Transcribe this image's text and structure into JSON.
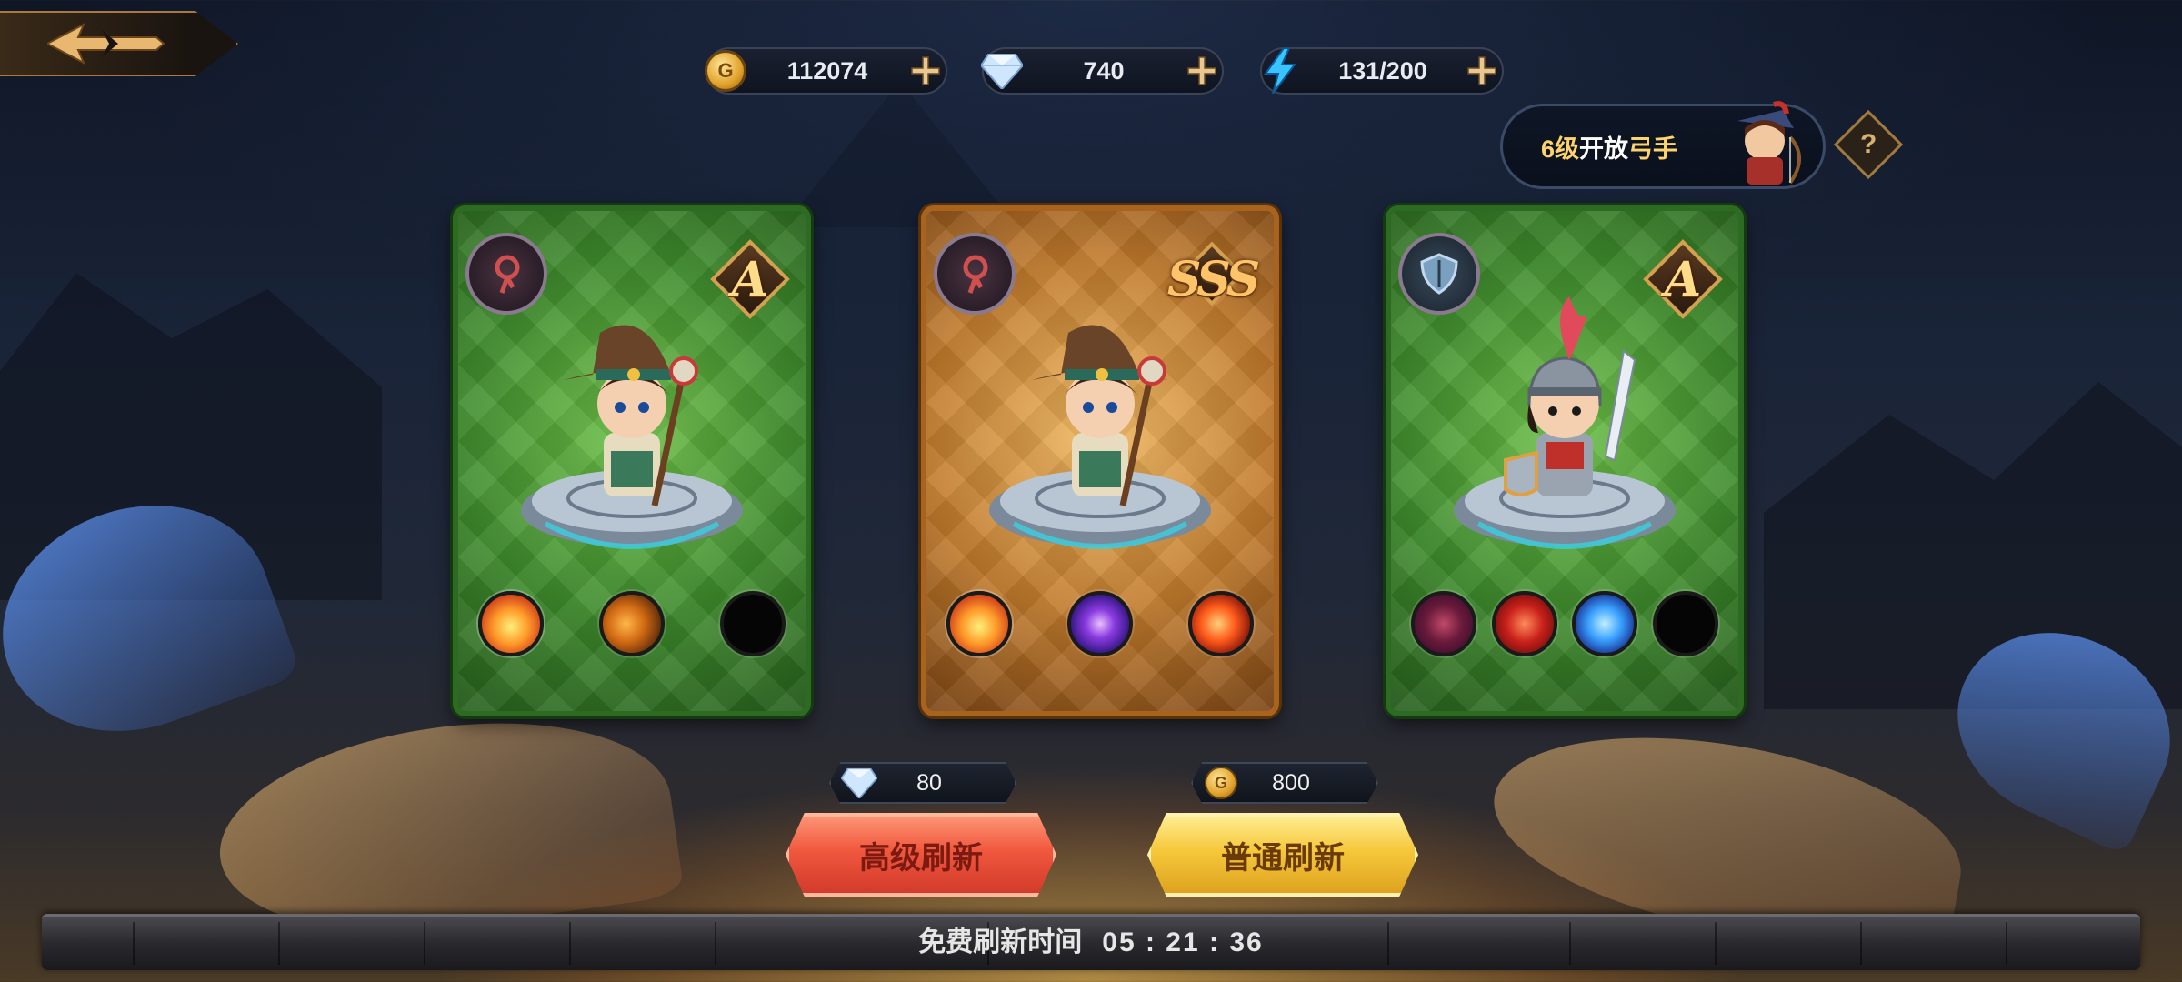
{
  "currencies": {
    "gold": "112074",
    "diamond": "740",
    "energy": "131/200"
  },
  "unlock_banner": {
    "level": "6级",
    "middle": "开放",
    "class": "弓手"
  },
  "help_label": "?",
  "cards": [
    {
      "grade": "A",
      "frame": "green",
      "class_icon": "staff-icon",
      "hero": "wizard-hero",
      "skills": [
        "fireball-icon",
        "flame-icon",
        "meteor-icon",
        "empty-slot"
      ]
    },
    {
      "grade": "SSS",
      "frame": "gold",
      "class_icon": "staff-icon",
      "hero": "wizard-hero",
      "skills": [
        "fireball-icon",
        "vortex-icon",
        "fire-slash-icon",
        "flame-icon"
      ]
    },
    {
      "grade": "A",
      "frame": "green",
      "class_icon": "shield-icon",
      "hero": "knight-hero",
      "skills": [
        "demon-icon",
        "claw-icon",
        "wave-icon",
        "empty-slot"
      ]
    }
  ],
  "premium_refresh": {
    "cost": "80",
    "currency": "diamond",
    "label": "高级刷新"
  },
  "normal_refresh": {
    "cost": "800",
    "currency": "gold",
    "label": "普通刷新"
  },
  "free_refresh": {
    "label": "免费刷新时间",
    "time": "05 : 21 : 36"
  },
  "colors": {
    "gold_text": "#ffd36b",
    "green_frame": "#2e6b22",
    "gold_frame": "#a8641e",
    "premium_button": "#f0583e",
    "normal_button": "#f6c83a"
  }
}
